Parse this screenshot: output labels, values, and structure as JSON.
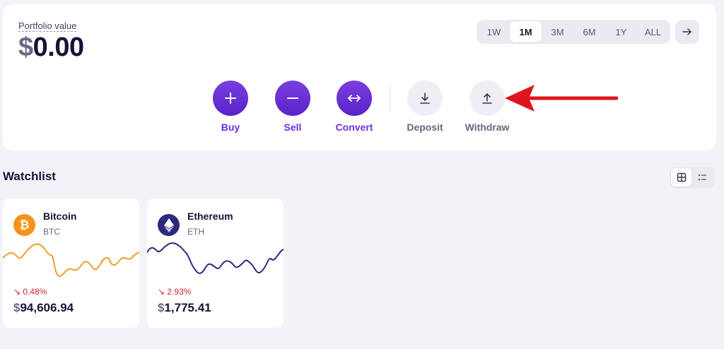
{
  "portfolio": {
    "label": "Portfolio value",
    "currency_symbol": "$",
    "value": "0.00"
  },
  "periods": {
    "items": [
      "1W",
      "1M",
      "3M",
      "6M",
      "1Y",
      "ALL"
    ],
    "active": "1M"
  },
  "actions": {
    "buy": "Buy",
    "sell": "Sell",
    "convert": "Convert",
    "deposit": "Deposit",
    "withdraw": "Withdraw"
  },
  "watchlist": {
    "title": "Watchlist",
    "coins": [
      {
        "name": "Bitcoin",
        "symbol": "BTC",
        "change": "0.48%",
        "change_direction": "down",
        "currency_symbol": "$",
        "price": "94,606.94",
        "color": "#f7931a"
      },
      {
        "name": "Ethereum",
        "symbol": "ETH",
        "change": "2.93%",
        "change_direction": "down",
        "currency_symbol": "$",
        "price": "1,775.41",
        "color": "#2c2a7a"
      }
    ]
  },
  "colors": {
    "accent": "#6d2fe3",
    "negative": "#d9233b",
    "annotation_arrow": "#e0141e"
  }
}
